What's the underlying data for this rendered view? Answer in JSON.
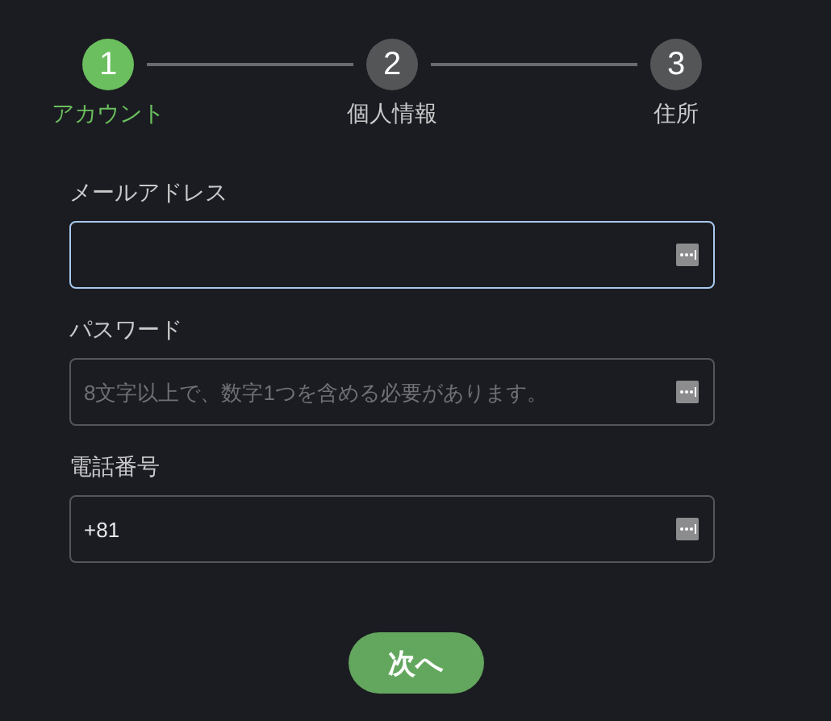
{
  "steps": [
    {
      "number": "1",
      "label": "アカウント",
      "selected": true
    },
    {
      "number": "2",
      "label": "個人情報",
      "selected": false
    },
    {
      "number": "3",
      "label": "住所",
      "selected": false
    }
  ],
  "fields": [
    {
      "label": "メールアドレス",
      "focused": true
    },
    {
      "label": "パスワード",
      "placeholder": "8文字以上で、数字1つを含める必要があります。",
      "focused": false
    },
    {
      "label": "電話番号",
      "value": "+81",
      "focused": false
    }
  ],
  "next_button": "次へ"
}
